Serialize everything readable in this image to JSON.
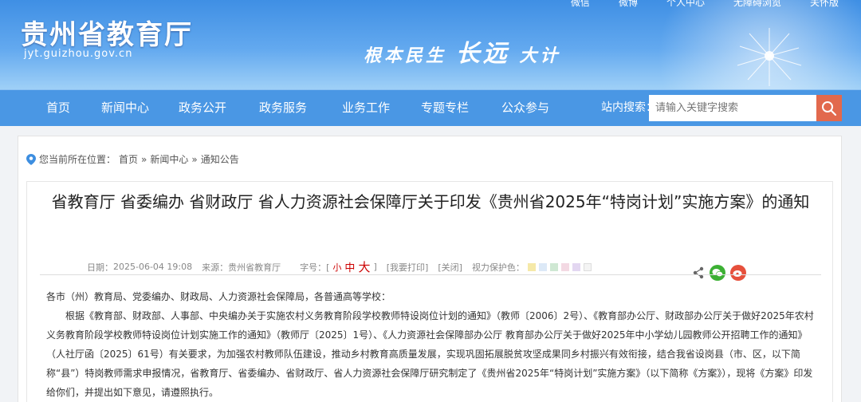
{
  "header": {
    "top_links": [
      "微信",
      "微博",
      "个人中心",
      "无障碍浏览",
      "关怀版"
    ],
    "site_title": "贵州省教育厅",
    "site_domain": "jyt.guizhou.gov.cn",
    "slogan_a": "根本民生",
    "slogan_b": "长远",
    "slogan_c": "大计"
  },
  "nav": {
    "items": [
      "首页",
      "新闻中心",
      "政务公开",
      "政务服务",
      "业务工作",
      "专题专栏",
      "公众参与"
    ],
    "search_label": "站内搜索：",
    "search_placeholder": "请输入关键字搜索"
  },
  "breadcrumb": {
    "prefix": "您当前所在位置：",
    "home": "首页",
    "sep1": "»",
    "section": "新闻中心",
    "sep2": "»",
    "current": "通知公告"
  },
  "article": {
    "title": "省教育厅 省委编办 省财政厅 省人力资源社会保障厅关于印发《贵州省2025年“特岗计划”实施方案》的通知",
    "date_label": "日期：",
    "date": "2025-06-04 19:08",
    "source_label": "来源：",
    "source": "贵州省教育厅",
    "font_label": "字号：[",
    "font_small": "小",
    "font_medium": "中",
    "font_large": "大",
    "font_close": "]",
    "print": "[我要打印]",
    "close": "[关闭]",
    "eye_label": "视力保护色：",
    "eye_colors": [
      "#f5e9a8",
      "#dce9f7",
      "#cfe8d3",
      "#f3d9e3",
      "#e3d7f1",
      "#f4f4f4"
    ],
    "greeting": "各市（州）教育局、党委编办、财政局、人力资源社会保障局，各普通高等学校：",
    "paragraph": "根据《教育部、财政部、人事部、中央编办关于实施农村义务教育阶段学校教师特设岗位计划的通知》（教师〔2006〕2号）、《教育部办公厅、财政部办公厅关于做好2025年农村义务教育阶段学校教师特设岗位计划实施工作的通知》（教师厅〔2025〕1号）、《人力资源社会保障部办公厅 教育部办公厅关于做好2025年中小学幼儿园教师公开招聘工作的通知》（人社厅函〔2025〕61号）有关要求，为加强农村教师队伍建设，推动乡村教育高质量发展，实现巩固拓展脱贫攻坚成果同乡村振兴有效衔接，结合我省设岗县（市、区，以下简称“县”）特岗教师需求申报情况，省教育厅、省委编办、省财政厅、省人力资源社会保障厅研究制定了《贵州省2025年“特岗计划”实施方案》（以下简称《方案》），现将《方案》印发给你们，并提出如下意见，请遵照执行。"
  }
}
